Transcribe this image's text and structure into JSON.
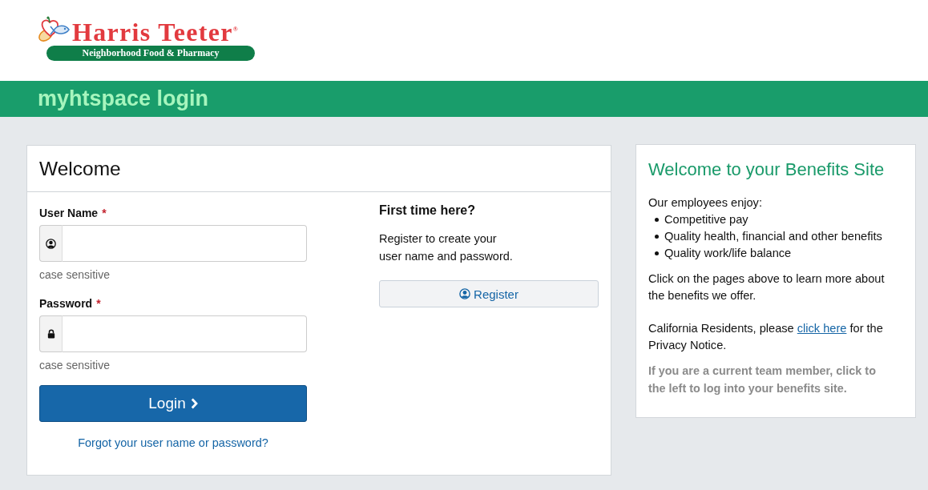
{
  "header": {
    "logo": {
      "name": "Harris Teeter$^{®}$",
      "tagline": "Neighborhood Food & Pharmacy"
    }
  },
  "banner": {
    "title": "myhtspace login"
  },
  "login_card": {
    "title": "Welcome",
    "fields": [
      {
        "kind": "text",
        "label": "User Name",
        "required": true,
        "required_mark": "*",
        "hint": "case sensitive"
      },
      {
        "kind": "password",
        "label": "Password",
        "required": true,
        "required_mark": "*",
        "hint": "case sensitive"
      }
    ],
    "login_button": "Login",
    "forgot_link": "Forgot your user name or password?",
    "register": {
      "heading": "First time here?",
      "text": "Register to create your\nuser name and password.",
      "button": "Register"
    }
  },
  "benefits_card": {
    "title": "Welcome to your Benefits Site",
    "intro": "Our employees enjoy:",
    "list": [
      "Competitive pay",
      "Quality health, financial and other benefits",
      "Quality work/life balance"
    ],
    "paragraph": "Click on the pages above to learn more about the benefits we offer.",
    "privacy": {
      "before": "California Residents, please ",
      "link": "click here",
      "after": " for the Privacy Notice."
    },
    "note": "If you are a current team member, click to the left to log into your benefits site."
  }
}
